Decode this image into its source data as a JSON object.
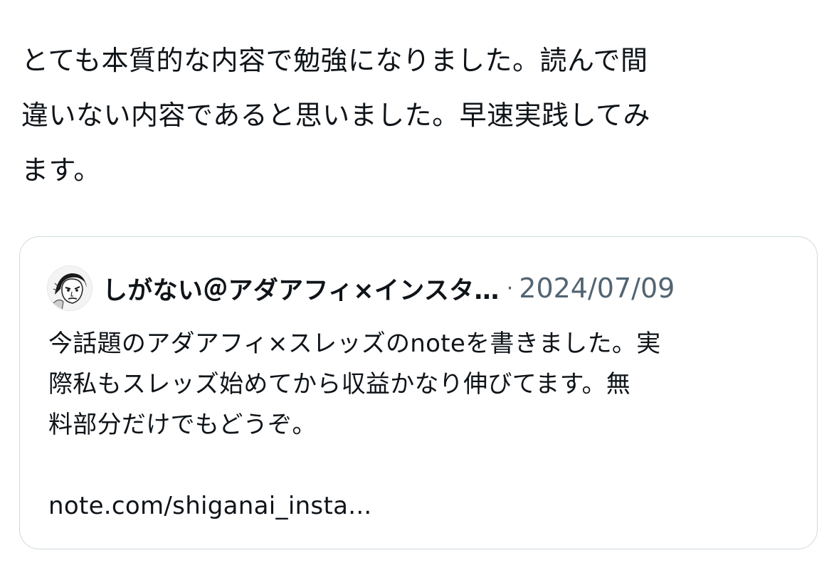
{
  "post": {
    "text_lines": [
      "とても本質的な内容で勉強になりました。読んで間",
      "違いない内容であると思いました。早速実践してみ",
      "ます。"
    ]
  },
  "quoted_post": {
    "author_display": "しがない＠アダアフィ×インスタ…",
    "separator": "·",
    "date": "2024/07/09",
    "avatar_icon": "author-avatar-icon",
    "body_lines": [
      "今話題のアダアフィ×スレッズのnoteを書きました。実",
      "際私もスレッズ始めてから収益かなり伸びてます。無",
      "料部分だけでもどうぞ。"
    ],
    "link": "note.com/shiganai_insta..."
  },
  "colors": {
    "text": "#0f1419",
    "secondary": "#536471",
    "border": "#cfd9de"
  }
}
